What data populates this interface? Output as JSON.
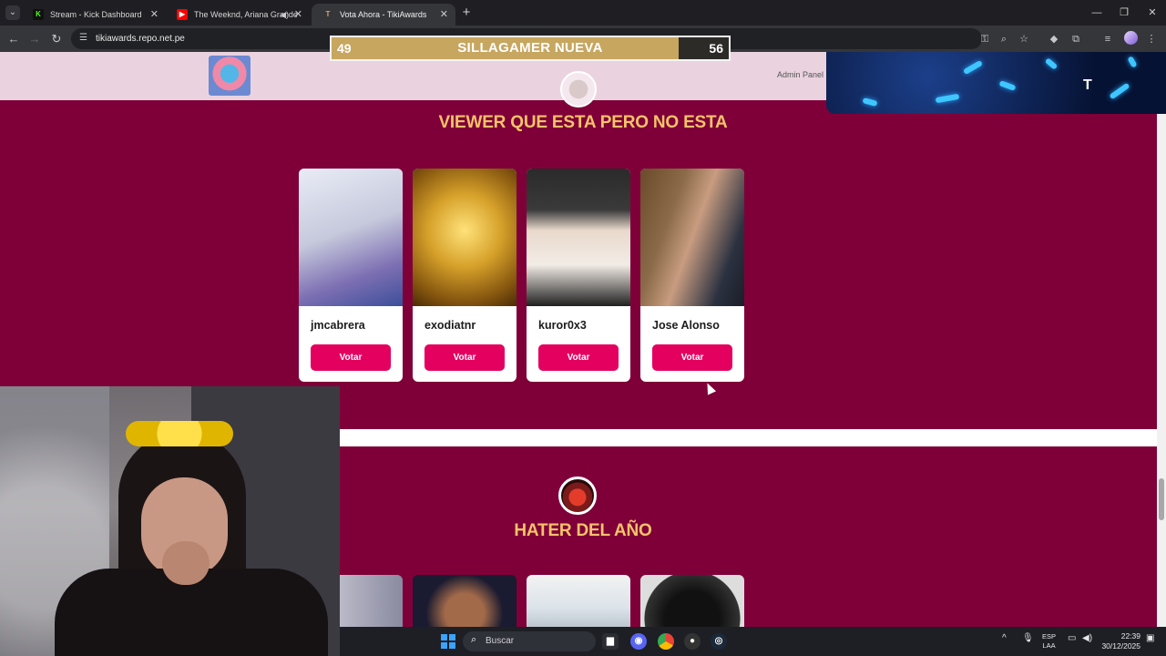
{
  "browser": {
    "tabs": [
      {
        "title": "Stream - Kick Dashboard",
        "favicon": "K",
        "favicon_color": "#53fc18",
        "active": false
      },
      {
        "title": "The Weeknd, Ariana Grande",
        "favicon": "▶",
        "favicon_color": "#ff0000",
        "active": false
      },
      {
        "title": "Vota Ahora - TikiAwards",
        "favicon": "T",
        "favicon_color": "#d7a65a",
        "active": true
      }
    ],
    "url": "tikiawards.repo.net.pe"
  },
  "site": {
    "admin_link": "Admin Panel",
    "categories": [
      {
        "title": "VIEWER QUE ESTA PERO NO ESTA",
        "nominees": [
          {
            "name": "jmcabrera",
            "vote_label": "Votar"
          },
          {
            "name": "exodiatnr",
            "vote_label": "Votar"
          },
          {
            "name": "kuror0x3",
            "vote_label": "Votar"
          },
          {
            "name": "Jose Alonso",
            "vote_label": "Votar"
          }
        ]
      },
      {
        "title": "HATER DEL AÑO"
      }
    ]
  },
  "overlay": {
    "poll": {
      "title": "SILLAGAMER NUEVA",
      "left_value": "49",
      "right_value": "56",
      "left_share": 0.874
    }
  },
  "taskbar": {
    "search_placeholder": "Buscar",
    "lang_line1": "ESP",
    "lang_line2": "LAA",
    "time": "22:39",
    "date": "30/12/2025"
  },
  "colors": {
    "page_bg": "#7f0038",
    "accent_title": "#f5c36a",
    "vote_button": "#e4005e"
  }
}
